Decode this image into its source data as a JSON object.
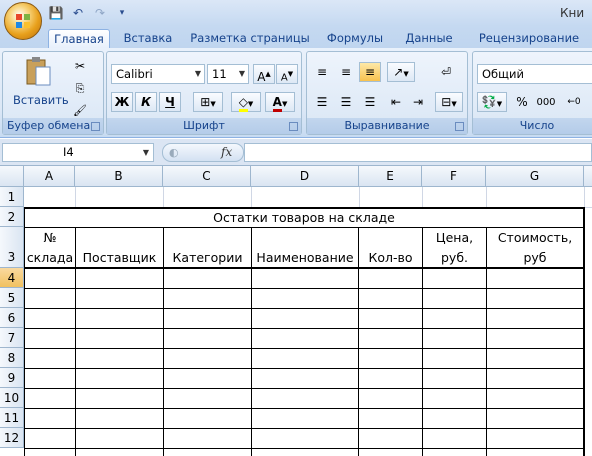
{
  "window": {
    "title_fragment": "Кни"
  },
  "quick_access": {
    "save_icon": "save-icon",
    "undo_icon": "undo-icon",
    "redo_icon": "redo-icon",
    "customize_icon": "customize-qat-icon"
  },
  "tabs": [
    "Главная",
    "Вставка",
    "Разметка страницы",
    "Формулы",
    "Данные",
    "Рецензирование"
  ],
  "active_tab": "Главная",
  "ribbon": {
    "clipboard": {
      "paste_label": "Вставить",
      "group_label": "Буфер обмена"
    },
    "font": {
      "name": "Calibri",
      "size": "11",
      "group_label": "Шрифт",
      "bold": "Ж",
      "italic": "К",
      "underline": "Ч",
      "font_color": "#c00000",
      "fill_color": "#ffff00"
    },
    "alignment": {
      "group_label": "Выравнивание"
    },
    "number": {
      "format": "Общий",
      "group_label": "Число",
      "percent": "%",
      "thousands": "000"
    }
  },
  "formula_bar": {
    "cell_ref": "I4",
    "fx": "fx",
    "content": ""
  },
  "columns": [
    "A",
    "B",
    "C",
    "D",
    "E",
    "F",
    "G"
  ],
  "rows": [
    "1",
    "2",
    "3",
    "4",
    "5",
    "6",
    "7",
    "8",
    "9",
    "10",
    "11",
    "12"
  ],
  "selected_row": "4",
  "sheet": {
    "title": "Остатки товаров на складе",
    "headers": [
      {
        "line1": "№",
        "line2": "склада"
      },
      {
        "line1": "",
        "line2": "Поставщик"
      },
      {
        "line1": "",
        "line2": "Категории"
      },
      {
        "line1": "",
        "line2": "Наименование"
      },
      {
        "line1": "",
        "line2": "Кол-во"
      },
      {
        "line1": "Цена,",
        "line2": "руб."
      },
      {
        "line1": "Стоимость,",
        "line2": "руб"
      }
    ]
  }
}
